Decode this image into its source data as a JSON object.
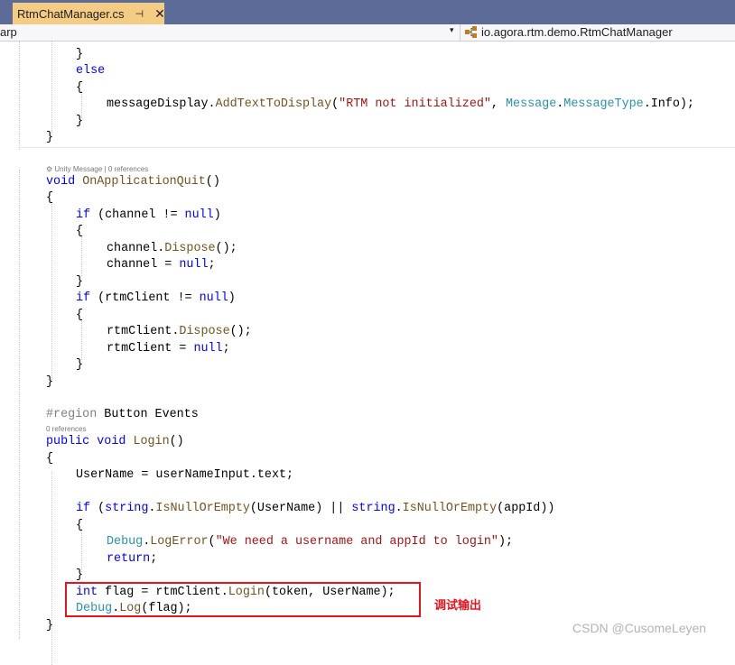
{
  "tab": {
    "file_name": "RtmChatManager.cs",
    "pin_glyph": "⊣",
    "close_glyph": "✕"
  },
  "navbar": {
    "project_fragment": "arp",
    "dropdown_glyph": "▾",
    "class_icon": "class-icon",
    "class_path": "io.agora.rtm.demo.RtmChatManager"
  },
  "codelens": {
    "unity_message": "⚙ Unity Message | 0 references",
    "refs_only": "0 references"
  },
  "code_lines": [
    [
      [
        "plain",
        "}"
      ]
    ],
    [
      [
        "kw",
        "else"
      ]
    ],
    [
      [
        "plain",
        "{"
      ]
    ],
    [
      [
        "plain",
        "messageDisplay."
      ],
      [
        "mt",
        "AddTextToDisplay"
      ],
      [
        "plain",
        "("
      ],
      [
        "str",
        "\"RTM not initialized\""
      ],
      [
        "plain",
        ", "
      ],
      [
        "ty",
        "Message"
      ],
      [
        "plain",
        "."
      ],
      [
        "ty",
        "MessageType"
      ],
      [
        "plain",
        ".Info);"
      ]
    ],
    [
      [
        "plain",
        "}"
      ]
    ],
    [
      [
        "plain",
        "}"
      ]
    ],
    [
      [
        "kw",
        "void "
      ],
      [
        "mt",
        "OnApplicationQuit"
      ],
      [
        "plain",
        "()"
      ]
    ],
    [
      [
        "plain",
        "{"
      ]
    ],
    [
      [
        "kw",
        "if"
      ],
      [
        "plain",
        " (channel != "
      ],
      [
        "kw",
        "null"
      ],
      [
        "plain",
        ")"
      ]
    ],
    [
      [
        "plain",
        "{"
      ]
    ],
    [
      [
        "plain",
        "channel."
      ],
      [
        "mt",
        "Dispose"
      ],
      [
        "plain",
        "();"
      ]
    ],
    [
      [
        "plain",
        "channel = "
      ],
      [
        "kw",
        "null"
      ],
      [
        "plain",
        ";"
      ]
    ],
    [
      [
        "plain",
        "}"
      ]
    ],
    [
      [
        "kw",
        "if"
      ],
      [
        "plain",
        " (rtmClient != "
      ],
      [
        "kw",
        "null"
      ],
      [
        "plain",
        ")"
      ]
    ],
    [
      [
        "plain",
        "{"
      ]
    ],
    [
      [
        "plain",
        "rtmClient."
      ],
      [
        "mt",
        "Dispose"
      ],
      [
        "plain",
        "();"
      ]
    ],
    [
      [
        "plain",
        "rtmClient = "
      ],
      [
        "kw",
        "null"
      ],
      [
        "plain",
        ";"
      ]
    ],
    [
      [
        "plain",
        "}"
      ]
    ],
    [
      [
        "plain",
        "}"
      ]
    ],
    [
      [
        "pp",
        "#region"
      ],
      [
        "plain",
        " Button Events"
      ]
    ],
    [
      [
        "kw",
        "public void "
      ],
      [
        "mt",
        "Login"
      ],
      [
        "plain",
        "()"
      ]
    ],
    [
      [
        "plain",
        "{"
      ]
    ],
    [
      [
        "plain",
        "UserName = userNameInput.text;"
      ]
    ],
    [
      [
        "kw",
        "if"
      ],
      [
        "plain",
        " ("
      ],
      [
        "kw",
        "string"
      ],
      [
        "plain",
        "."
      ],
      [
        "mt",
        "IsNullOrEmpty"
      ],
      [
        "plain",
        "(UserName) || "
      ],
      [
        "kw",
        "string"
      ],
      [
        "plain",
        "."
      ],
      [
        "mt",
        "IsNullOrEmpty"
      ],
      [
        "plain",
        "(appId))"
      ]
    ],
    [
      [
        "plain",
        "{"
      ]
    ],
    [
      [
        "ty",
        "Debug"
      ],
      [
        "plain",
        "."
      ],
      [
        "mt",
        "LogError"
      ],
      [
        "plain",
        "("
      ],
      [
        "str",
        "\"We need a username and appId to login\""
      ],
      [
        "plain",
        ");"
      ]
    ],
    [
      [
        "kw",
        "return"
      ],
      [
        "plain",
        ";"
      ]
    ],
    [
      [
        "plain",
        "}"
      ]
    ],
    [
      [
        "kw",
        "int"
      ],
      [
        "plain",
        " flag = rtmClient."
      ],
      [
        "mt",
        "Login"
      ],
      [
        "plain",
        "(token, UserName);"
      ]
    ],
    [
      [
        "ty",
        "Debug"
      ],
      [
        "plain",
        "."
      ],
      [
        "mt",
        "Log"
      ],
      [
        "plain",
        "(flag);"
      ]
    ],
    [
      [
        "plain",
        "}"
      ]
    ]
  ],
  "annotation": {
    "text": "调试输出",
    "color": "#e8141d"
  },
  "watermark": "CSDN @CusomeLeyen",
  "colors": {
    "keyword": "#0000ff",
    "string": "#a31515",
    "type": "#2b91af",
    "method": "#74531f",
    "preprocessor": "#808080",
    "tab_active": "#f5cc84",
    "tab_strip": "#5d6b99"
  }
}
